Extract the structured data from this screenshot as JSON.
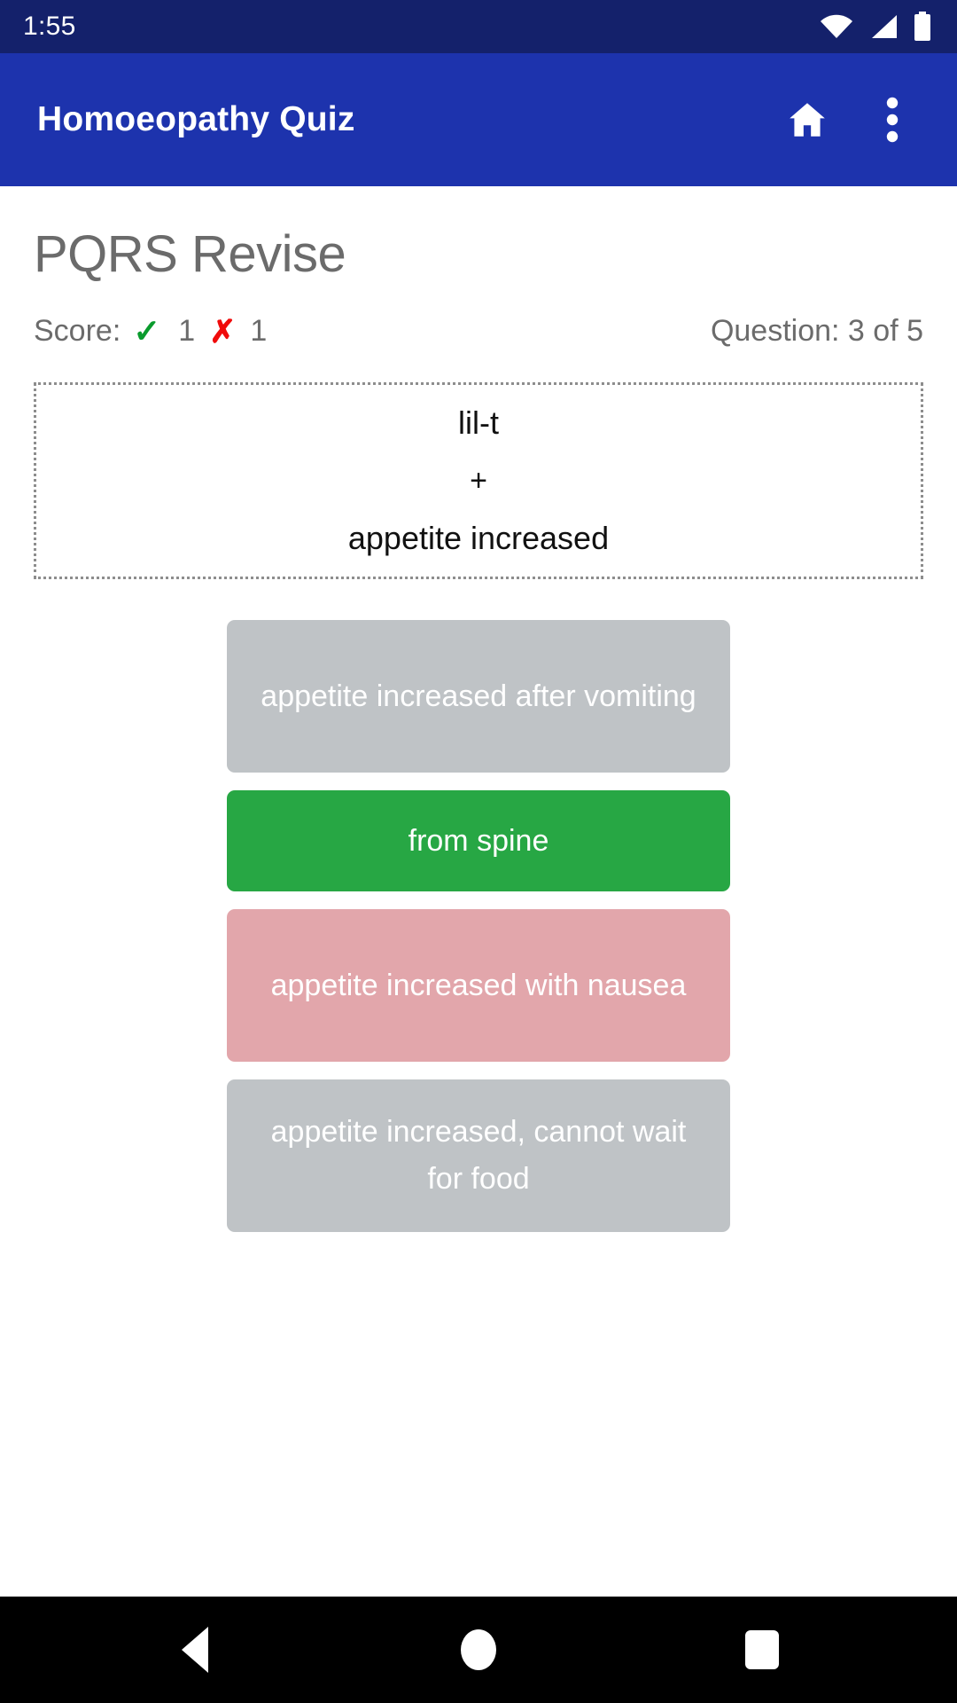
{
  "status_bar": {
    "clock": "1:55",
    "icons": [
      "wifi-icon",
      "cellular-signal-icon",
      "battery-icon"
    ],
    "background_color": "#14216b"
  },
  "app_bar": {
    "title": "Homoeopathy Quiz",
    "background_color": "#1d33ad",
    "actions": [
      {
        "name": "home-icon",
        "label": "Home"
      },
      {
        "name": "overflow-menu-icon",
        "label": "More options"
      }
    ]
  },
  "page": {
    "title": "PQRS Revise",
    "score": {
      "label": "Score:",
      "correct_icon": "✓",
      "correct_count": "1",
      "wrong_icon": "✗",
      "wrong_count": "1",
      "correct_color": "#0a9b2d",
      "wrong_color": "#f00b0b"
    },
    "question_counter": "Question: 3 of 5"
  },
  "question_card": {
    "remedy": "lil-t",
    "operator": "+",
    "symptom": "appetite increased"
  },
  "options": [
    {
      "label": "appetite increased after vomiting",
      "state": "neutral",
      "color": "#bfc3c6",
      "lines": 2
    },
    {
      "label": "from spine",
      "state": "correct",
      "color": "#27a744",
      "lines": 1
    },
    {
      "label": "appetite increased with nausea",
      "state": "wrong",
      "color": "#e2a6ab",
      "lines": 2
    },
    {
      "label": "appetite increased, cannot wait for food",
      "state": "neutral",
      "color": "#bfc3c6",
      "lines": 2
    }
  ],
  "nav_bar": {
    "background_color": "#000000",
    "buttons": [
      {
        "name": "back-icon",
        "label": "Back"
      },
      {
        "name": "home-circle-icon",
        "label": "Home"
      },
      {
        "name": "recents-square-icon",
        "label": "Recents"
      }
    ]
  }
}
